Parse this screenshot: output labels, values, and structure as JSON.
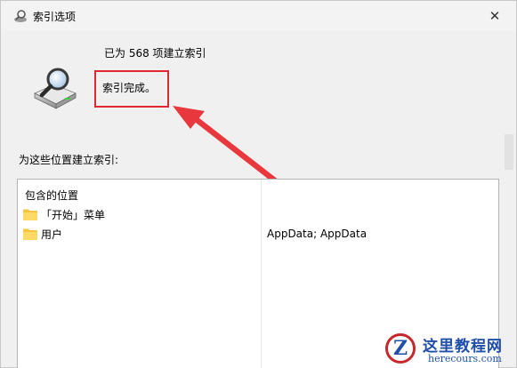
{
  "window": {
    "title": "索引选项",
    "close_icon": "close-icon"
  },
  "status": {
    "indexed_count": "已为 568 项建立索引",
    "message": "索引完成。"
  },
  "locations": {
    "label": "为这些位置建立索引:",
    "column_header": "包含的位置",
    "items": [
      {
        "name": "「开始」菜单",
        "exclude": ""
      },
      {
        "name": "用户",
        "exclude": "AppData; AppData"
      }
    ]
  },
  "annotation": {
    "highlight_color": "#e0282e"
  },
  "watermark": {
    "title": "这里教程网",
    "url": "herecours.com"
  }
}
